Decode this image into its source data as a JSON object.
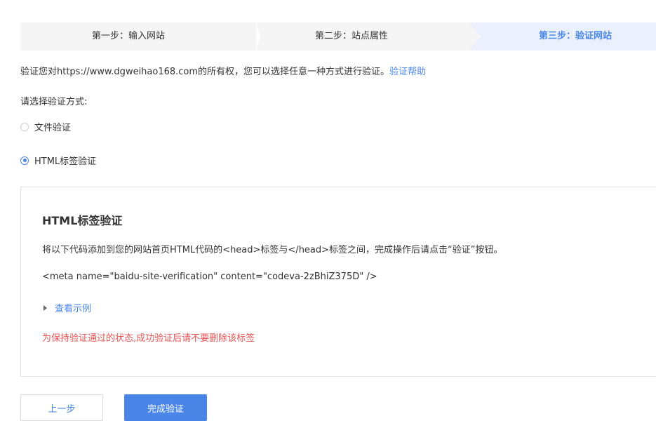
{
  "steps": {
    "step1": "第一步：输入网站",
    "step2": "第二步：站点属性",
    "step3": "第三步：验证网站"
  },
  "intro": {
    "text": "验证您对https://www.dgweihao168.com的所有权，您可以选择任意一种方式进行验证。",
    "help_link": "验证帮助"
  },
  "choose_label": "请选择验证方式:",
  "options": {
    "file": "文件验证",
    "html": "HTML标签验证",
    "selected": "html"
  },
  "panel": {
    "title": "HTML标签验证",
    "description": "将以下代码添加到您的网站首页HTML代码的<head>标签与</head>标签之间，完成操作后请点击“验证”按钮。",
    "code": "<meta name=\"baidu-site-verification\" content=\"codeva-2zBhiZ375D\" />",
    "example_link": "查看示例",
    "warning": "为保持验证通过的状态,成功验证后请不要删除该标签"
  },
  "buttons": {
    "prev": "上一步",
    "done": "完成验证"
  },
  "colors": {
    "accent": "#4a86e8",
    "warning": "#e65454",
    "active_step_bg": "#eaf1fd"
  }
}
